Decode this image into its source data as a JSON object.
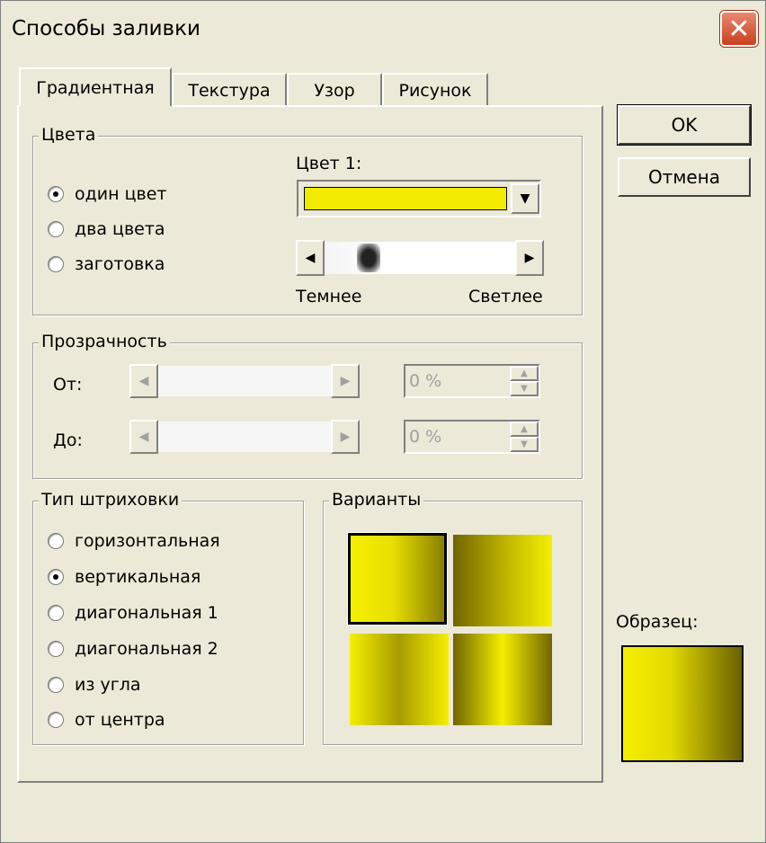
{
  "window": {
    "title": "Способы заливки"
  },
  "tabs": [
    "Градиентная",
    "Текстура",
    "Узор",
    "Рисунок"
  ],
  "colors_group": {
    "legend": "Цвета",
    "options": [
      "один цвет",
      "два цвета",
      "заготовка"
    ],
    "selected": "один цвет",
    "color1_label": "Цвет 1:",
    "color1_value": "#f2ea00",
    "darker": "Темнее",
    "lighter": "Светлее"
  },
  "transparency": {
    "legend": "Прозрачность",
    "from_label": "От:",
    "to_label": "До:",
    "from_value": "0 %",
    "to_value": "0 %"
  },
  "shading": {
    "legend": "Тип штриховки",
    "options": [
      "горизонтальная",
      "вертикальная",
      "диагональная 1",
      "диагональная 2",
      "из угла",
      "от центра"
    ],
    "selected": "вертикальная"
  },
  "variants": {
    "legend": "Варианты"
  },
  "sample": {
    "label": "Образец:"
  },
  "buttons": {
    "ok": "OK",
    "cancel": "Отмена"
  },
  "icons": {
    "close": "close-icon",
    "dropdown": "chevron-down-icon",
    "left": "arrow-left-icon",
    "right": "arrow-right-icon",
    "spin": "spin-updown-icon"
  }
}
